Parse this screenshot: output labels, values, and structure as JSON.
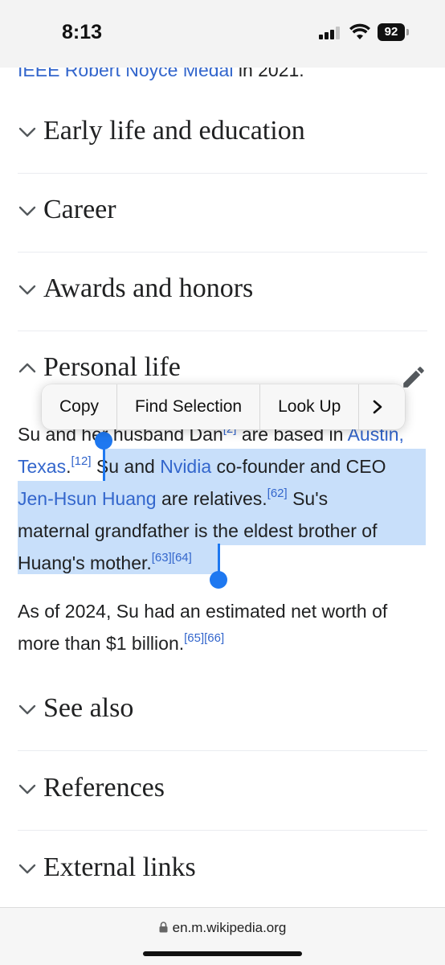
{
  "status_bar": {
    "time": "8:13",
    "battery": "92"
  },
  "cut_line": {
    "link_text": "IEEE Robert Noyce Medal",
    "after_text": " in 2021."
  },
  "sections": {
    "early_life": "Early life and education",
    "career": "Career",
    "awards": "Awards and honors",
    "personal_life": "Personal life",
    "see_also": "See also",
    "references": "References",
    "external_links": "External links"
  },
  "context_menu": {
    "copy": "Copy",
    "find_selection": "Find Selection",
    "look_up": "Look Up",
    "more": "›"
  },
  "personal_para": {
    "l1_a": "Su and her husband Dan",
    "l1_ref": "[2]",
    "l1_b": " are based in ",
    "l1_link": "Austin,",
    "l2_link": "Texas",
    "l2_a": ".",
    "l2_ref": "[12]",
    "l2_b": " Su and ",
    "l2_link2": "Nvidia",
    "l2_c": " co-founder and CEO",
    "l3_link": "Jen-Hsun Huang",
    "l3_a": " are relatives.",
    "l3_ref": "[62]",
    "l3_b": " Su's",
    "l4": "maternal grandfather is the eldest brother of",
    "l5_a": "Huang's mother.",
    "l5_ref": "[63][64]"
  },
  "networth_para": {
    "l1": "As of 2024, Su had an estimated net worth of",
    "l2": "more than $1 billion.",
    "l2_ref": "[65][66]"
  },
  "bottom_bar": {
    "url": "en.m.wikipedia.org"
  },
  "colors": {
    "link": "#3366cc",
    "selection": "#c8dffa",
    "handle": "#1e78f0"
  }
}
